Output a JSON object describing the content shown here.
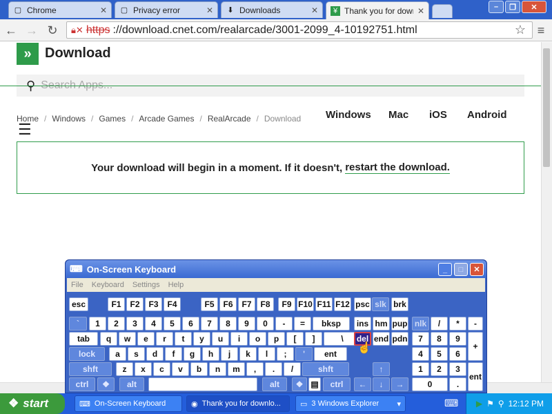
{
  "browser": {
    "tabs": [
      {
        "label": "Chrome",
        "active": false
      },
      {
        "label": "Privacy error",
        "active": false
      },
      {
        "label": "Downloads",
        "active": false
      },
      {
        "label": "Thank you for down",
        "active": true
      }
    ],
    "url_scheme": "https",
    "url_rest": "://download.cnet.com/realarcade/3001-2099_4-10192751.html"
  },
  "page": {
    "logo_text": "Download",
    "search_placeholder": "Search Apps...",
    "breadcrumbs": [
      "Home",
      "Windows",
      "Games",
      "Arcade Games",
      "RealArcade",
      "Download"
    ],
    "breadcrumb_sep": "/",
    "platforms": [
      "Windows",
      "Mac",
      "iOS",
      "Android"
    ],
    "notice_text": "Your download will begin in a moment. If it doesn't,",
    "notice_link": "restart the download."
  },
  "osk": {
    "title": "On-Screen Keyboard",
    "menu": [
      "File",
      "Keyboard",
      "Settings",
      "Help"
    ],
    "rows": {
      "r0": [
        "esc",
        "F1",
        "F2",
        "F3",
        "F4",
        "F5",
        "F6",
        "F7",
        "F8",
        "F9",
        "F10",
        "F11",
        "F12",
        "psc",
        "slk",
        "brk"
      ],
      "r1": [
        "`",
        "1",
        "2",
        "3",
        "4",
        "5",
        "6",
        "7",
        "8",
        "9",
        "0",
        "-",
        "=",
        "bksp",
        "ins",
        "hm",
        "pup",
        "nlk",
        "/",
        "*",
        "-"
      ],
      "r2": [
        "tab",
        "q",
        "w",
        "e",
        "r",
        "t",
        "y",
        "u",
        "i",
        "o",
        "p",
        "[",
        "]",
        "\\",
        "del",
        "end",
        "pdn",
        "7",
        "8",
        "9",
        "+"
      ],
      "r3": [
        "lock",
        "a",
        "s",
        "d",
        "f",
        "g",
        "h",
        "j",
        "k",
        "l",
        ";",
        "'",
        "ent",
        "4",
        "5",
        "6"
      ],
      "r4": [
        "shft",
        "z",
        "x",
        "c",
        "v",
        "b",
        "n",
        "m",
        ",",
        ".",
        "/",
        "shft",
        "↑",
        "1",
        "2",
        "3",
        "ent"
      ],
      "r5": [
        "ctrl",
        "alt",
        "alt",
        "ctrl",
        "←",
        "↓",
        "→",
        "0",
        "."
      ]
    }
  },
  "taskbar": {
    "start_label": "start",
    "items": [
      "On-Screen Keyboard",
      "Thank you for downlo...",
      "3 Windows Explorer"
    ],
    "clock": "12:12 PM"
  }
}
